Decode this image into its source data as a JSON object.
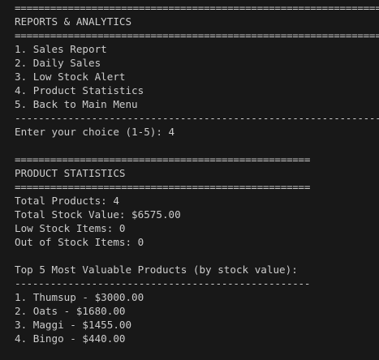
{
  "menu": {
    "rule_top": "==============================================================",
    "title": "REPORTS & ANALYTICS",
    "rule_mid": "==============================================================",
    "options": [
      "1. Sales Report",
      "2. Daily Sales",
      "3. Low Stock Alert",
      "4. Product Statistics",
      "5. Back to Main Menu"
    ],
    "rule_bottom": "--------------------------------------------------------------",
    "prompt": "Enter your choice (1-5): 4"
  },
  "stats": {
    "rule_top": "==================================================",
    "title": "PRODUCT STATISTICS",
    "rule_mid": "==================================================",
    "total_products": "Total Products: 4",
    "total_stock_value": "Total Stock Value: $6575.00",
    "low_stock_items": "Low Stock Items: 0",
    "out_of_stock_items": "Out of Stock Items: 0"
  },
  "top_products": {
    "heading": "Top 5 Most Valuable Products (by stock value):",
    "rule": "--------------------------------------------------",
    "items": [
      "1. Thumsup - $3000.00",
      "2. Oats - $1680.00",
      "3. Maggi - $1455.00",
      "4. Bingo - $440.00"
    ]
  }
}
